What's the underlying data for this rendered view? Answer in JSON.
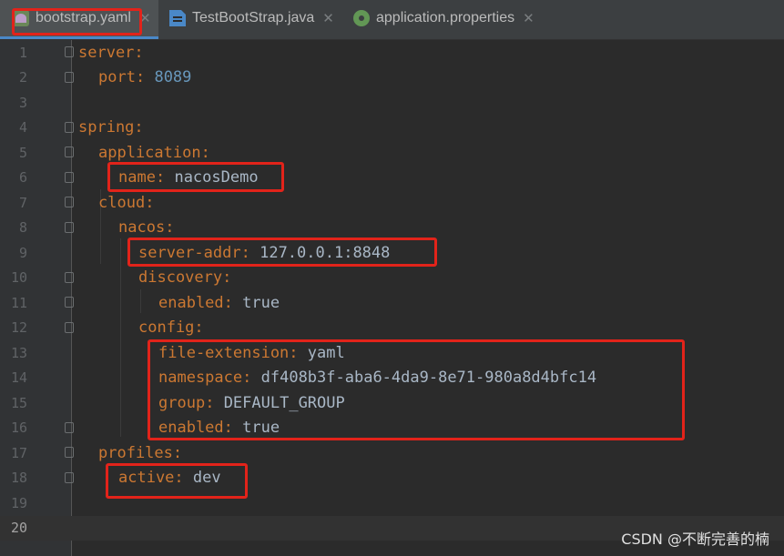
{
  "tabs": [
    {
      "label": "bootstrap.yaml",
      "icon": "yaml-file-icon",
      "active": true
    },
    {
      "label": "TestBootStrap.java",
      "icon": "java-file-icon",
      "active": false
    },
    {
      "label": "application.properties",
      "icon": "properties-file-icon",
      "active": false
    }
  ],
  "editor": {
    "lines": [
      {
        "num": "1",
        "key": "server",
        "value": ""
      },
      {
        "num": "2",
        "key": "port",
        "value": "8089"
      },
      {
        "num": "3",
        "key": "",
        "value": ""
      },
      {
        "num": "4",
        "key": "spring",
        "value": ""
      },
      {
        "num": "5",
        "key": "application",
        "value": ""
      },
      {
        "num": "6",
        "key": "name",
        "value": "nacosDemo"
      },
      {
        "num": "7",
        "key": "cloud",
        "value": ""
      },
      {
        "num": "8",
        "key": "nacos",
        "value": ""
      },
      {
        "num": "9",
        "key": "server-addr",
        "value": "127.0.0.1:8848"
      },
      {
        "num": "10",
        "key": "discovery",
        "value": ""
      },
      {
        "num": "11",
        "key": "enabled",
        "value": "true"
      },
      {
        "num": "12",
        "key": "config",
        "value": ""
      },
      {
        "num": "13",
        "key": "file-extension",
        "value": "yaml"
      },
      {
        "num": "14",
        "key": "namespace",
        "value": "df408b3f-aba6-4da9-8e71-980a8d4bfc14"
      },
      {
        "num": "15",
        "key": "group",
        "value": "DEFAULT_GROUP"
      },
      {
        "num": "16",
        "key": "enabled",
        "value": "true"
      },
      {
        "num": "17",
        "key": "profiles",
        "value": ""
      },
      {
        "num": "18",
        "key": "active",
        "value": "dev"
      },
      {
        "num": "19",
        "key": "",
        "value": ""
      },
      {
        "num": "20",
        "key": "",
        "value": ""
      }
    ],
    "colon": ":"
  },
  "watermark": "CSDN @不断完善的楠",
  "colors": {
    "accent_red": "#e2231a",
    "key": "#cc7832",
    "number": "#6897bb",
    "text": "#a9b7c6"
  }
}
